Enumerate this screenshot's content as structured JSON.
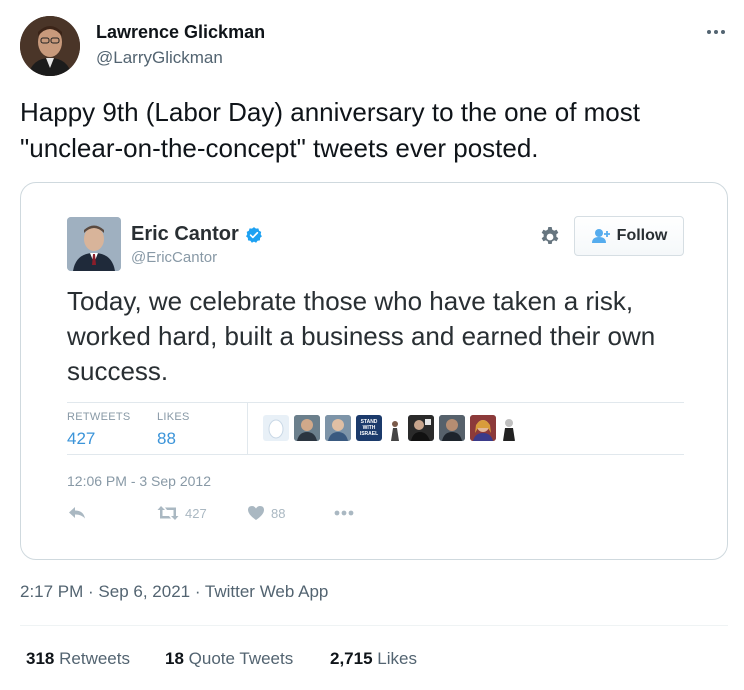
{
  "tweet": {
    "author_name": "Lawrence Glickman",
    "author_handle": "@LarryGlickman",
    "text": "Happy 9th (Labor Day) anniversary to the one of most \"unclear-on-the-concept\" tweets ever posted.",
    "meta": "2:17 PM · Sep 6, 2021 · Twitter Web App",
    "retweets_count": "318",
    "retweets_label": "Retweets",
    "quotes_count": "18",
    "quotes_label": "Quote Tweets",
    "likes_count": "2,715",
    "likes_label": "Likes"
  },
  "embedded": {
    "name": "Eric Cantor",
    "handle": "@EricCantor",
    "follow_label": "Follow",
    "text": "Today, we celebrate those who have taken a risk, worked hard, built a business and earned their own success.",
    "retweets_label": "RETWEETS",
    "retweets_value": "427",
    "likes_label": "LIKES",
    "likes_value": "88",
    "badge_text": "STAND WITH ISRAEL",
    "timestamp": "12:06 PM - 3 Sep 2012",
    "action_retweet_count": "427",
    "action_like_count": "88"
  },
  "icons": [
    "more-icon",
    "verified-icon",
    "gear-icon",
    "follow-person-icon",
    "reply-icon",
    "retweet-icon",
    "heart-icon",
    "more-dots-icon"
  ],
  "colors": {
    "link_blue": "#3b94d9",
    "verified_blue": "#1da1f2",
    "muted": "#536471",
    "border": "#cfd9de"
  }
}
